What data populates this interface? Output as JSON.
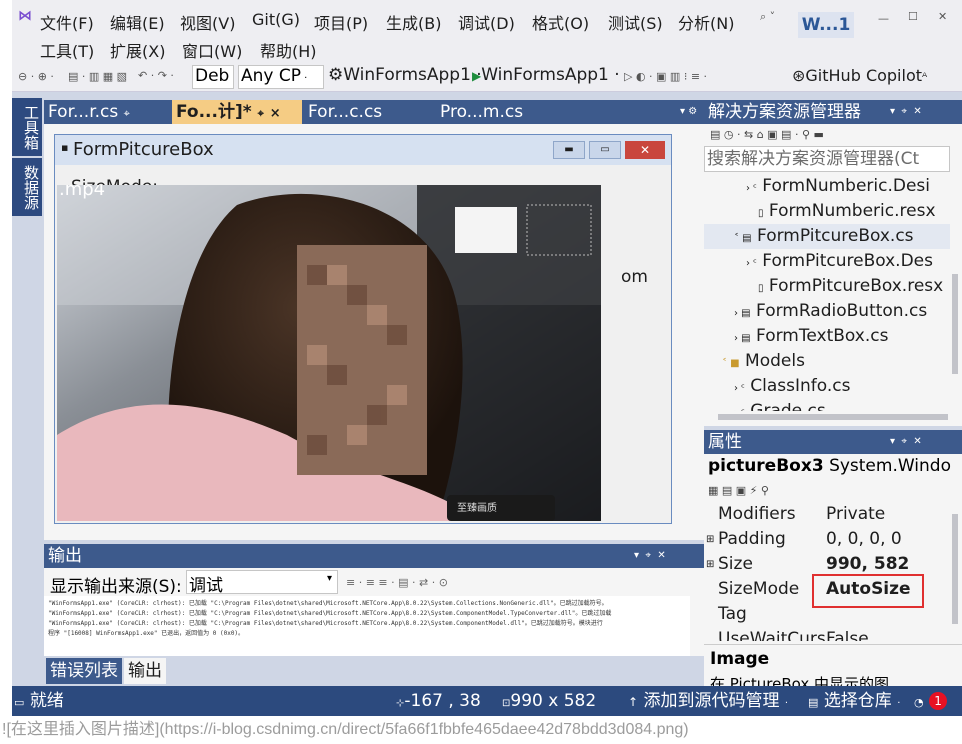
{
  "menu": {
    "row1": [
      "文件(F)",
      "编辑(E)",
      "视图(V)",
      "Git(G)",
      "项目(P)",
      "生成(B)",
      "调试(D)",
      "格式(O)",
      "测试(S)",
      "分析(N)"
    ],
    "row2": [
      "工具(T)",
      "扩展(X)",
      "窗口(W)",
      "帮助(H)"
    ],
    "search_icon": "search-icon",
    "badge": "W...1"
  },
  "toolbar": {
    "config": "Deb",
    "platform": "Any CP",
    "project1": "WinFormsApp1",
    "project2": "WinFormsApp1",
    "copilot": "GitHub Copilot"
  },
  "side_tabs": [
    "工具箱",
    "数据源"
  ],
  "doc_tabs": [
    {
      "label": "For...r.cs",
      "pin": "⌖"
    },
    {
      "label": "Fo...计]*",
      "pin": "⌖",
      "close": "×"
    },
    {
      "label": "For...c.cs"
    },
    {
      "label": "Pro...m.cs"
    }
  ],
  "designer": {
    "form_title": "FormPitcureBox",
    "label_sizemode": "SizeMode:",
    "video_label": ".mp4",
    "partial_text": "om",
    "video_caption": "至臻画质"
  },
  "solution_explorer": {
    "title": "解决方案资源管理器",
    "search_placeholder": "搜索解决方案资源管理器(Ct",
    "items": [
      {
        "label": "FormNumberic.Desi",
        "icon": "cs-file-icon"
      },
      {
        "label": "FormNumberic.resx",
        "icon": "resx-file-icon"
      },
      {
        "label": "FormPitcureBox.cs",
        "icon": "form-file-icon"
      },
      {
        "label": "FormPitcureBox.Des",
        "icon": "cs-file-icon"
      },
      {
        "label": "FormPitcureBox.resx",
        "icon": "resx-file-icon"
      },
      {
        "label": "FormRadioButton.cs",
        "icon": "form-file-icon"
      },
      {
        "label": "FormTextBox.cs",
        "icon": "form-file-icon"
      },
      {
        "label": "Models",
        "icon": "folder-icon"
      },
      {
        "label": "ClassInfo.cs",
        "icon": "cs-file-icon"
      },
      {
        "label": "Grade.cs",
        "icon": "cs-file-icon"
      }
    ]
  },
  "properties": {
    "title": "属性",
    "object": "pictureBox3",
    "object_type": "System.Windo",
    "rows": [
      {
        "name": "Modifiers",
        "value": "Private"
      },
      {
        "name": "Padding",
        "value": "0, 0, 0, 0"
      },
      {
        "name": "Size",
        "value": "990, 582"
      },
      {
        "name": "SizeMode",
        "value": "AutoSize"
      },
      {
        "name": "Tag",
        "value": ""
      },
      {
        "name": "UseWaitCurs",
        "value": "False"
      }
    ],
    "desc_title": "Image",
    "desc_text": "在 PictureBox 中显示的图"
  },
  "output": {
    "title": "输出",
    "source_label": "显示输出来源(S):",
    "source_value": "调试",
    "lines": [
      "\"WinFormsApp1.exe\" (CoreCLR: clrhost): 已加载 \"C:\\Program Files\\dotnet\\shared\\Microsoft.NETCore.App\\8.0.22\\System.Collections.NonGeneric.dll\"。已跳过加载符号。",
      "\"WinFormsApp1.exe\" (CoreCLR: clrhost): 已加载 \"C:\\Program Files\\dotnet\\shared\\Microsoft.NETCore.App\\8.0.22\\System.ComponentModel.TypeConverter.dll\"。已跳过加载",
      "\"WinFormsApp1.exe\" (CoreCLR: clrhost): 已加载 \"C:\\Program Files\\dotnet\\shared\\Microsoft.NETCore.App\\8.0.22\\System.ComponentModel.dll\"。已跳过加载符号。模块进行",
      "程序 \"[16008] WinFormsApp1.exe\" 已退出，返回值为 0 (0x0)。"
    ],
    "bottom_tabs": [
      "错误列表",
      "输出"
    ]
  },
  "status": {
    "ready": "就绪",
    "position": "-167 , 38",
    "size": "990 x 582",
    "add_source": "添加到源代码管理",
    "select_repo": "选择仓库",
    "notif_count": "1"
  },
  "caption": "![在这里插入图片描述](https://i-blog.csdnimg.cn/direct/5fa66f1fbbfe465daee42d78bdd3d084.png)",
  "colors": {
    "accent": "#3d5a8c",
    "active_tab": "#f5cc84",
    "highlight_box": "#e03030",
    "notif": "#e81123"
  }
}
